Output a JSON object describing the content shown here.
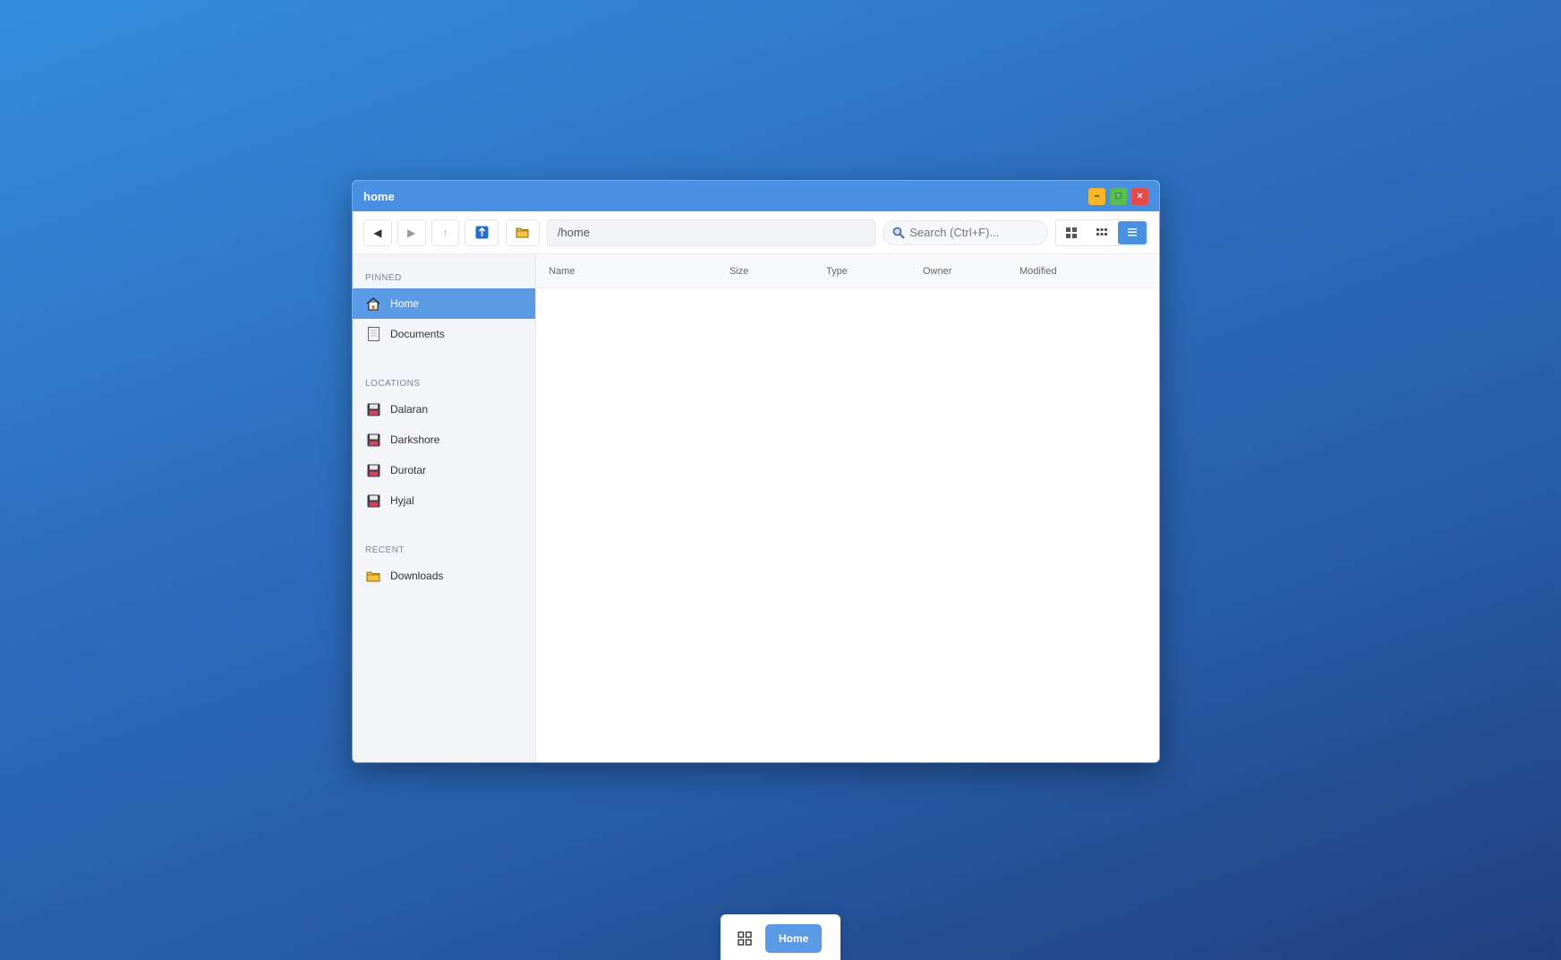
{
  "window": {
    "title": "home",
    "controls": {
      "minimize": "–",
      "maximize": "□",
      "close": "×"
    }
  },
  "toolbar": {
    "back_icon": "◀",
    "forward_icon": "▶",
    "up_icon": "↑",
    "path": "/home",
    "search_placeholder": "Search (Ctrl+F)..."
  },
  "sidebar": {
    "sections": [
      {
        "title": "PINNED",
        "items": [
          {
            "label": "Home",
            "icon": "home-icon",
            "active": true
          },
          {
            "label": "Documents",
            "icon": "document-icon",
            "active": false
          }
        ]
      },
      {
        "title": "LOCATIONS",
        "items": [
          {
            "label": "Dalaran",
            "icon": "drive-icon"
          },
          {
            "label": "Darkshore",
            "icon": "drive-icon"
          },
          {
            "label": "Durotar",
            "icon": "drive-icon"
          },
          {
            "label": "Hyjal",
            "icon": "drive-icon"
          }
        ]
      },
      {
        "title": "RECENT",
        "items": [
          {
            "label": "Downloads",
            "icon": "folder-icon"
          }
        ]
      }
    ]
  },
  "table": {
    "columns": [
      "Name",
      "Size",
      "Type",
      "Owner",
      "Modified"
    ],
    "rows": []
  },
  "taskbar": {
    "active_task": "Home"
  },
  "colors": {
    "accent": "#4a90e2",
    "selection": "#5b9be5",
    "minimize": "#f6b826",
    "maximize": "#5bbc52",
    "close": "#e54b4b"
  }
}
